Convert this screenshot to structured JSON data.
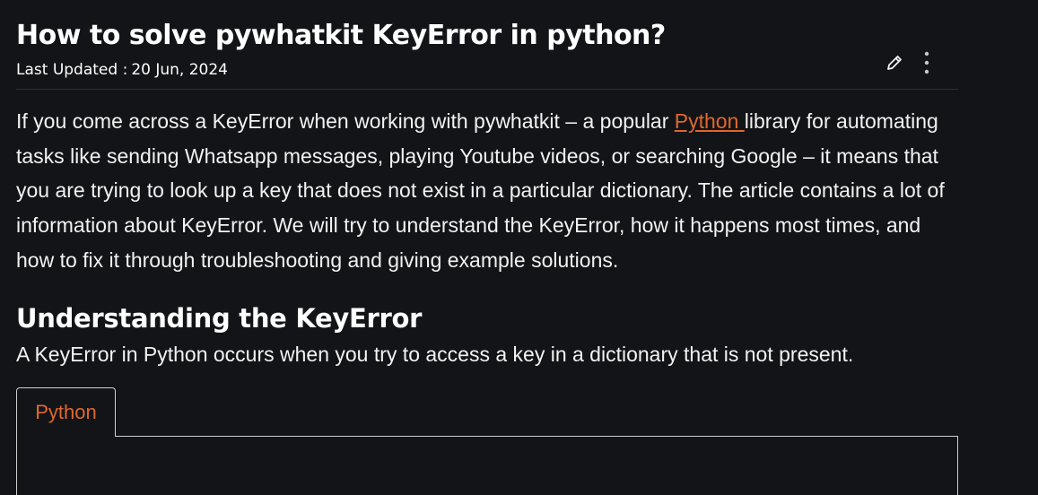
{
  "article": {
    "title": "How to solve pywhatkit KeyError in python?",
    "last_updated_label": "Last Updated :",
    "last_updated_date": "20 Jun, 2024",
    "intro_before_link": "If you come across a KeyError when working with pywhatkit – a popular ",
    "intro_link_text": "Python ",
    "intro_after_link": "library for automating tasks like sending Whatsapp messages, playing Youtube videos, or searching Google – it means that you are trying to look up a key that does not exist in a particular dictionary. The article contains a lot of information about KeyError. We will try to understand the KeyError, how it happens most times, and how to fix it through troubleshooting and giving example solutions.",
    "section_heading": "Understanding the KeyError",
    "section_text": "A KeyError in Python occurs when you try to access a key in a dictionary that is not present."
  },
  "actions": {
    "edit_icon": "pencil-icon",
    "more_icon": "kebab-menu-icon"
  },
  "code_block": {
    "tabs": [
      {
        "label": "Python"
      }
    ]
  },
  "colors": {
    "background": "#131417",
    "text": "#f2f2f2",
    "accent": "#e0672f"
  }
}
